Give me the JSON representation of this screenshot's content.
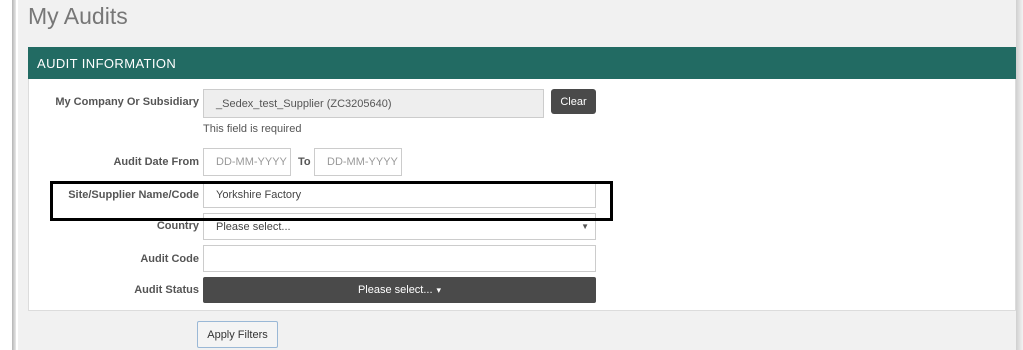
{
  "page": {
    "title": "My Audits"
  },
  "panel": {
    "header": "AUDIT INFORMATION"
  },
  "form": {
    "company": {
      "label": "My Company Or Subsidiary",
      "value": "_Sedex_test_Supplier (ZC3205640)",
      "help": "This field is required",
      "clear_label": "Clear"
    },
    "audit_date": {
      "label": "Audit Date From",
      "from_placeholder": "DD-MM-YYYY",
      "to_label": "To",
      "to_placeholder": "DD-MM-YYYY"
    },
    "site": {
      "label": "Site/Supplier Name/Code",
      "value": "Yorkshire Factory"
    },
    "country": {
      "label": "Country",
      "selected": "Please select..."
    },
    "audit_code": {
      "label": "Audit Code",
      "value": ""
    },
    "audit_status": {
      "label": "Audit Status",
      "selected": "Please select..."
    }
  },
  "actions": {
    "apply_label": "Apply Filters"
  },
  "colors": {
    "header_bg": "#226b63",
    "button_dark": "#4a4a4a",
    "page_bg": "#f1f1f1",
    "highlight_border": "#000000"
  },
  "icons": {
    "select_arrow": "chevron-down-icon",
    "status_caret": "caret-down-icon"
  }
}
